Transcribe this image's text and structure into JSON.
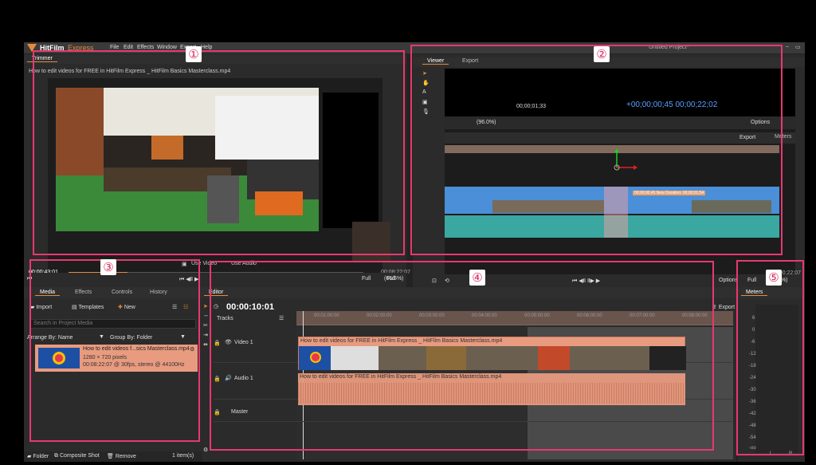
{
  "app": {
    "logo_text": "HitFilm",
    "logo_sub": "Express",
    "project_title": "Untitled Project*",
    "menu": [
      "File",
      "Edit",
      "Effects",
      "Window",
      "Export",
      "Help"
    ]
  },
  "annotations": [
    "①",
    "②",
    "③",
    "④",
    "⑤"
  ],
  "trimmer": {
    "tab": "Trimmer",
    "file_name": "How to edit videos for FREE in HitFilm Express _ HitFilm Basics Masterclass.mp4",
    "time_left": "00:00:43:01",
    "time_right": "00:08:22:07",
    "btn_use_video": "Use Video",
    "btn_use_audio": "Use Audio",
    "quality": "Full",
    "zoom": "(66.5%)"
  },
  "viewer": {
    "tabs": [
      "Viewer",
      "Export"
    ],
    "time_right": "00:00:22:07",
    "quality": "Full",
    "zoom": "(49.5%)",
    "options": "Options",
    "inner_timecode_left": "00;00;01;33",
    "inner_timecode_right": "+00;00;00;45 00;00;22;02",
    "inner_zoom": "(96.0%)",
    "inner_options": "Options",
    "inner_meters": "Meters",
    "inner_export": "Export",
    "inner_note": "00;00;00;45 New Duration: 00;00;01;54"
  },
  "media": {
    "tabs": [
      "Media",
      "Effects",
      "Controls",
      "History"
    ],
    "import_label": "Import",
    "templates_label": "Templates",
    "new_label": "New",
    "search_placeholder": "Search in Project Media",
    "arrange_label": "Arrange By: Name",
    "group_label": "Group By: Folder",
    "item": {
      "name": "How to edit videos f...sics Masterclass.mp4",
      "resolution": "1280 × 720 pixels",
      "details": "00:08:22:07 @ 30fps, stereo @ 44100Hz"
    },
    "footer_folder": "Folder",
    "footer_composite": "Composite Shot",
    "footer_remove": "Remove",
    "footer_count": "1 item(s)"
  },
  "editor": {
    "tab": "Editor",
    "timecode": "00:00:10:01",
    "tracks_label": "Tracks",
    "export_label": "Export",
    "ruler_ticks": [
      "00:01:00:00",
      "00:02:00:00",
      "00:03:00:00",
      "00:04:00:00",
      "00:05:00:00",
      "00:06:00:00",
      "00:07:00:00",
      "00:08:00:00"
    ],
    "video_track": "Video 1",
    "audio_track": "Audio 1",
    "master_track": "Master",
    "video_clip": "How to edit videos for FREE in HitFilm Express _ HitFilm Basics Masterclass.mp4",
    "audio_clip": "How to edit videos for FREE in HitFilm Express _ HitFilm Basics Masterclass.mp4"
  },
  "meters": {
    "tab": "Meters",
    "labels": [
      "6",
      "0",
      "-6",
      "-12",
      "-18",
      "-24",
      "-30",
      "-36",
      "-42",
      "-48",
      "-54",
      "-oo"
    ],
    "lr": [
      "L",
      "R"
    ]
  },
  "colors": {
    "accent": "#e8386f",
    "clip": "#e89b7f",
    "brand": "#e58b3b"
  }
}
